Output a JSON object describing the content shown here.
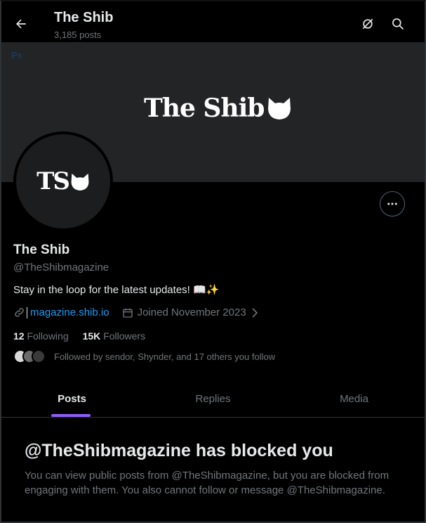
{
  "header": {
    "title": "The Shib",
    "post_count": "3,185 posts"
  },
  "banner": {
    "corner_text": "Ps",
    "logo_text": "The Shib"
  },
  "avatar": {
    "text": "TS"
  },
  "profile": {
    "name": "The Shib",
    "handle": "@TheShibmagazine",
    "bio": "Stay in the loop for the latest updates! 📖✨",
    "website": "magazine.shib.io",
    "joined": "Joined November 2023"
  },
  "stats": {
    "following_count": "12",
    "following_label": "Following",
    "followers_count": "15K",
    "followers_label": "Followers"
  },
  "followed_by": "Followed by sendor, Shynder, and 17 others you follow",
  "tabs": [
    {
      "label": "Posts"
    },
    {
      "label": "Replies"
    },
    {
      "label": "Media"
    }
  ],
  "blocked": {
    "title": "@TheShibmagazine has blocked you",
    "body": "You can view public posts from @TheShibmagazine, but you are blocked from engaging with them. You also cannot follow or message @TheShibmagazine."
  },
  "colors": {
    "accent": "#8b5cf6",
    "link": "#1d9bf0",
    "muted": "#71767b"
  }
}
